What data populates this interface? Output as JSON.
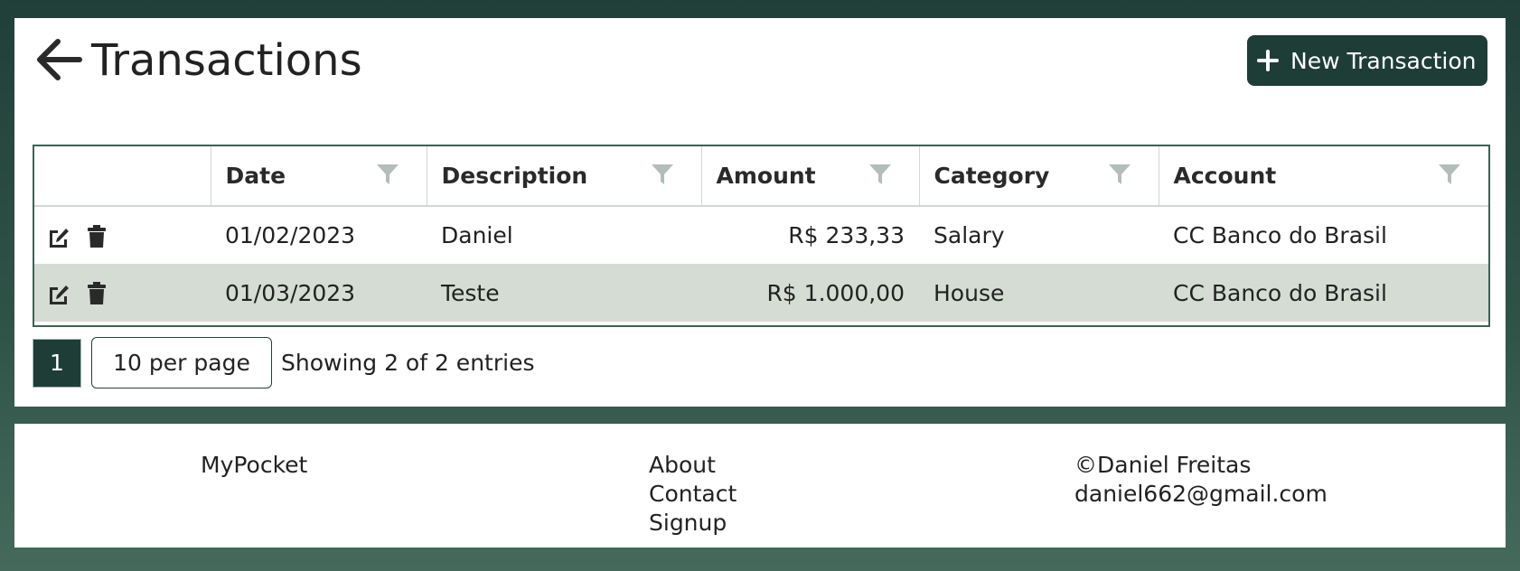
{
  "header": {
    "title": "Transactions",
    "new_button_label": "New Transaction"
  },
  "table": {
    "columns": [
      "",
      "Date",
      "Description",
      "Amount",
      "Category",
      "Account"
    ],
    "rows": [
      {
        "date": "01/02/2023",
        "description": "Daniel",
        "amount": "R$ 233,33",
        "category": "Salary",
        "account": "CC Banco do Brasil"
      },
      {
        "date": "01/03/2023",
        "description": "Teste",
        "amount": "R$ 1.000,00",
        "category": "House",
        "account": "CC Banco do Brasil"
      }
    ]
  },
  "pagination": {
    "current_page": "1",
    "per_page": "10 per page",
    "entries_text": "Showing 2 of 2 entries"
  },
  "footer": {
    "brand": "MyPocket",
    "links": [
      "About",
      "Contact",
      "Signup"
    ],
    "copyright": "©Daniel Freitas",
    "email": "daniel662@gmail.com"
  },
  "icons": {
    "back": "arrow-left-icon",
    "new": "plus-icon",
    "filter": "filter-icon",
    "edit": "edit-icon",
    "delete": "trash-icon"
  },
  "colors": {
    "brand": "#1e3d36",
    "row_alt": "#d4dcd4",
    "filter_icon": "#b3bdb9"
  }
}
